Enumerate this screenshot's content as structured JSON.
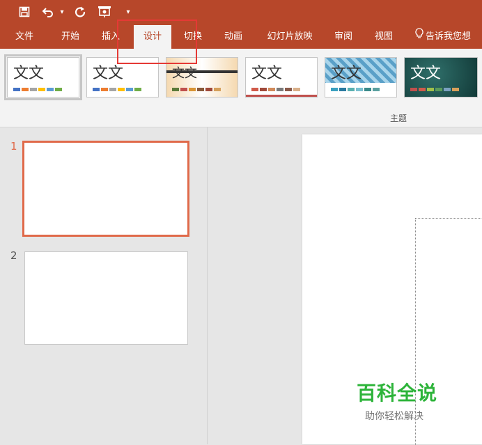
{
  "quick_access": {
    "icons": [
      "save-icon",
      "undo-icon",
      "redo-icon",
      "present-from-start-icon",
      "customize-qat-icon"
    ]
  },
  "ribbon": {
    "tabs": [
      {
        "label": "文件",
        "active": false
      },
      {
        "label": "开始",
        "active": false
      },
      {
        "label": "插入",
        "active": false
      },
      {
        "label": "设计",
        "active": true
      },
      {
        "label": "切换",
        "active": false
      },
      {
        "label": "动画",
        "active": false
      },
      {
        "label": "幻灯片放映",
        "active": false
      },
      {
        "label": "审阅",
        "active": false
      },
      {
        "label": "视图",
        "active": false
      }
    ],
    "tell_me": "告诉我您想"
  },
  "themes": {
    "group_label": "主题",
    "items": [
      {
        "title": "文文",
        "colors": [
          "#4472c4",
          "#ed7d31",
          "#a5a5a5",
          "#ffc000",
          "#5b9bd5",
          "#70ad47"
        ]
      },
      {
        "title": "文文",
        "colors": [
          "#4472c4",
          "#ed7d31",
          "#a5a5a5",
          "#ffc000",
          "#5b9bd5",
          "#70ad47"
        ]
      },
      {
        "title": "文文",
        "colors": [
          "#5a7a3a",
          "#c0504d",
          "#d99434",
          "#8a5a3a",
          "#a04a3a",
          "#d5a05a"
        ]
      },
      {
        "title": "文文",
        "colors": [
          "#d05a4a",
          "#a04a3a",
          "#d08a5a",
          "#7a7a7a",
          "#8a5a4a",
          "#d9b08a"
        ]
      },
      {
        "title": "文文",
        "colors": [
          "#3aa0c0",
          "#2a7aa0",
          "#5ab0b0",
          "#7ac0d0",
          "#3a8a8a",
          "#5aa0a0"
        ]
      },
      {
        "title": "文文",
        "colors": [
          "#c0504d",
          "#d05a4a",
          "#a0c04a",
          "#5a9a5a",
          "#7aa0c0",
          "#d9a05a"
        ]
      }
    ]
  },
  "slides": [
    {
      "number": "1",
      "selected": true
    },
    {
      "number": "2",
      "selected": false
    }
  ],
  "watermark": {
    "title": "百科全说",
    "subtitle": "助你轻松解决"
  },
  "colors": {
    "accent": "#b7472a",
    "highlight": "#e53935",
    "selected_thumb": "#e06a4a",
    "watermark_green": "#2db43a"
  }
}
